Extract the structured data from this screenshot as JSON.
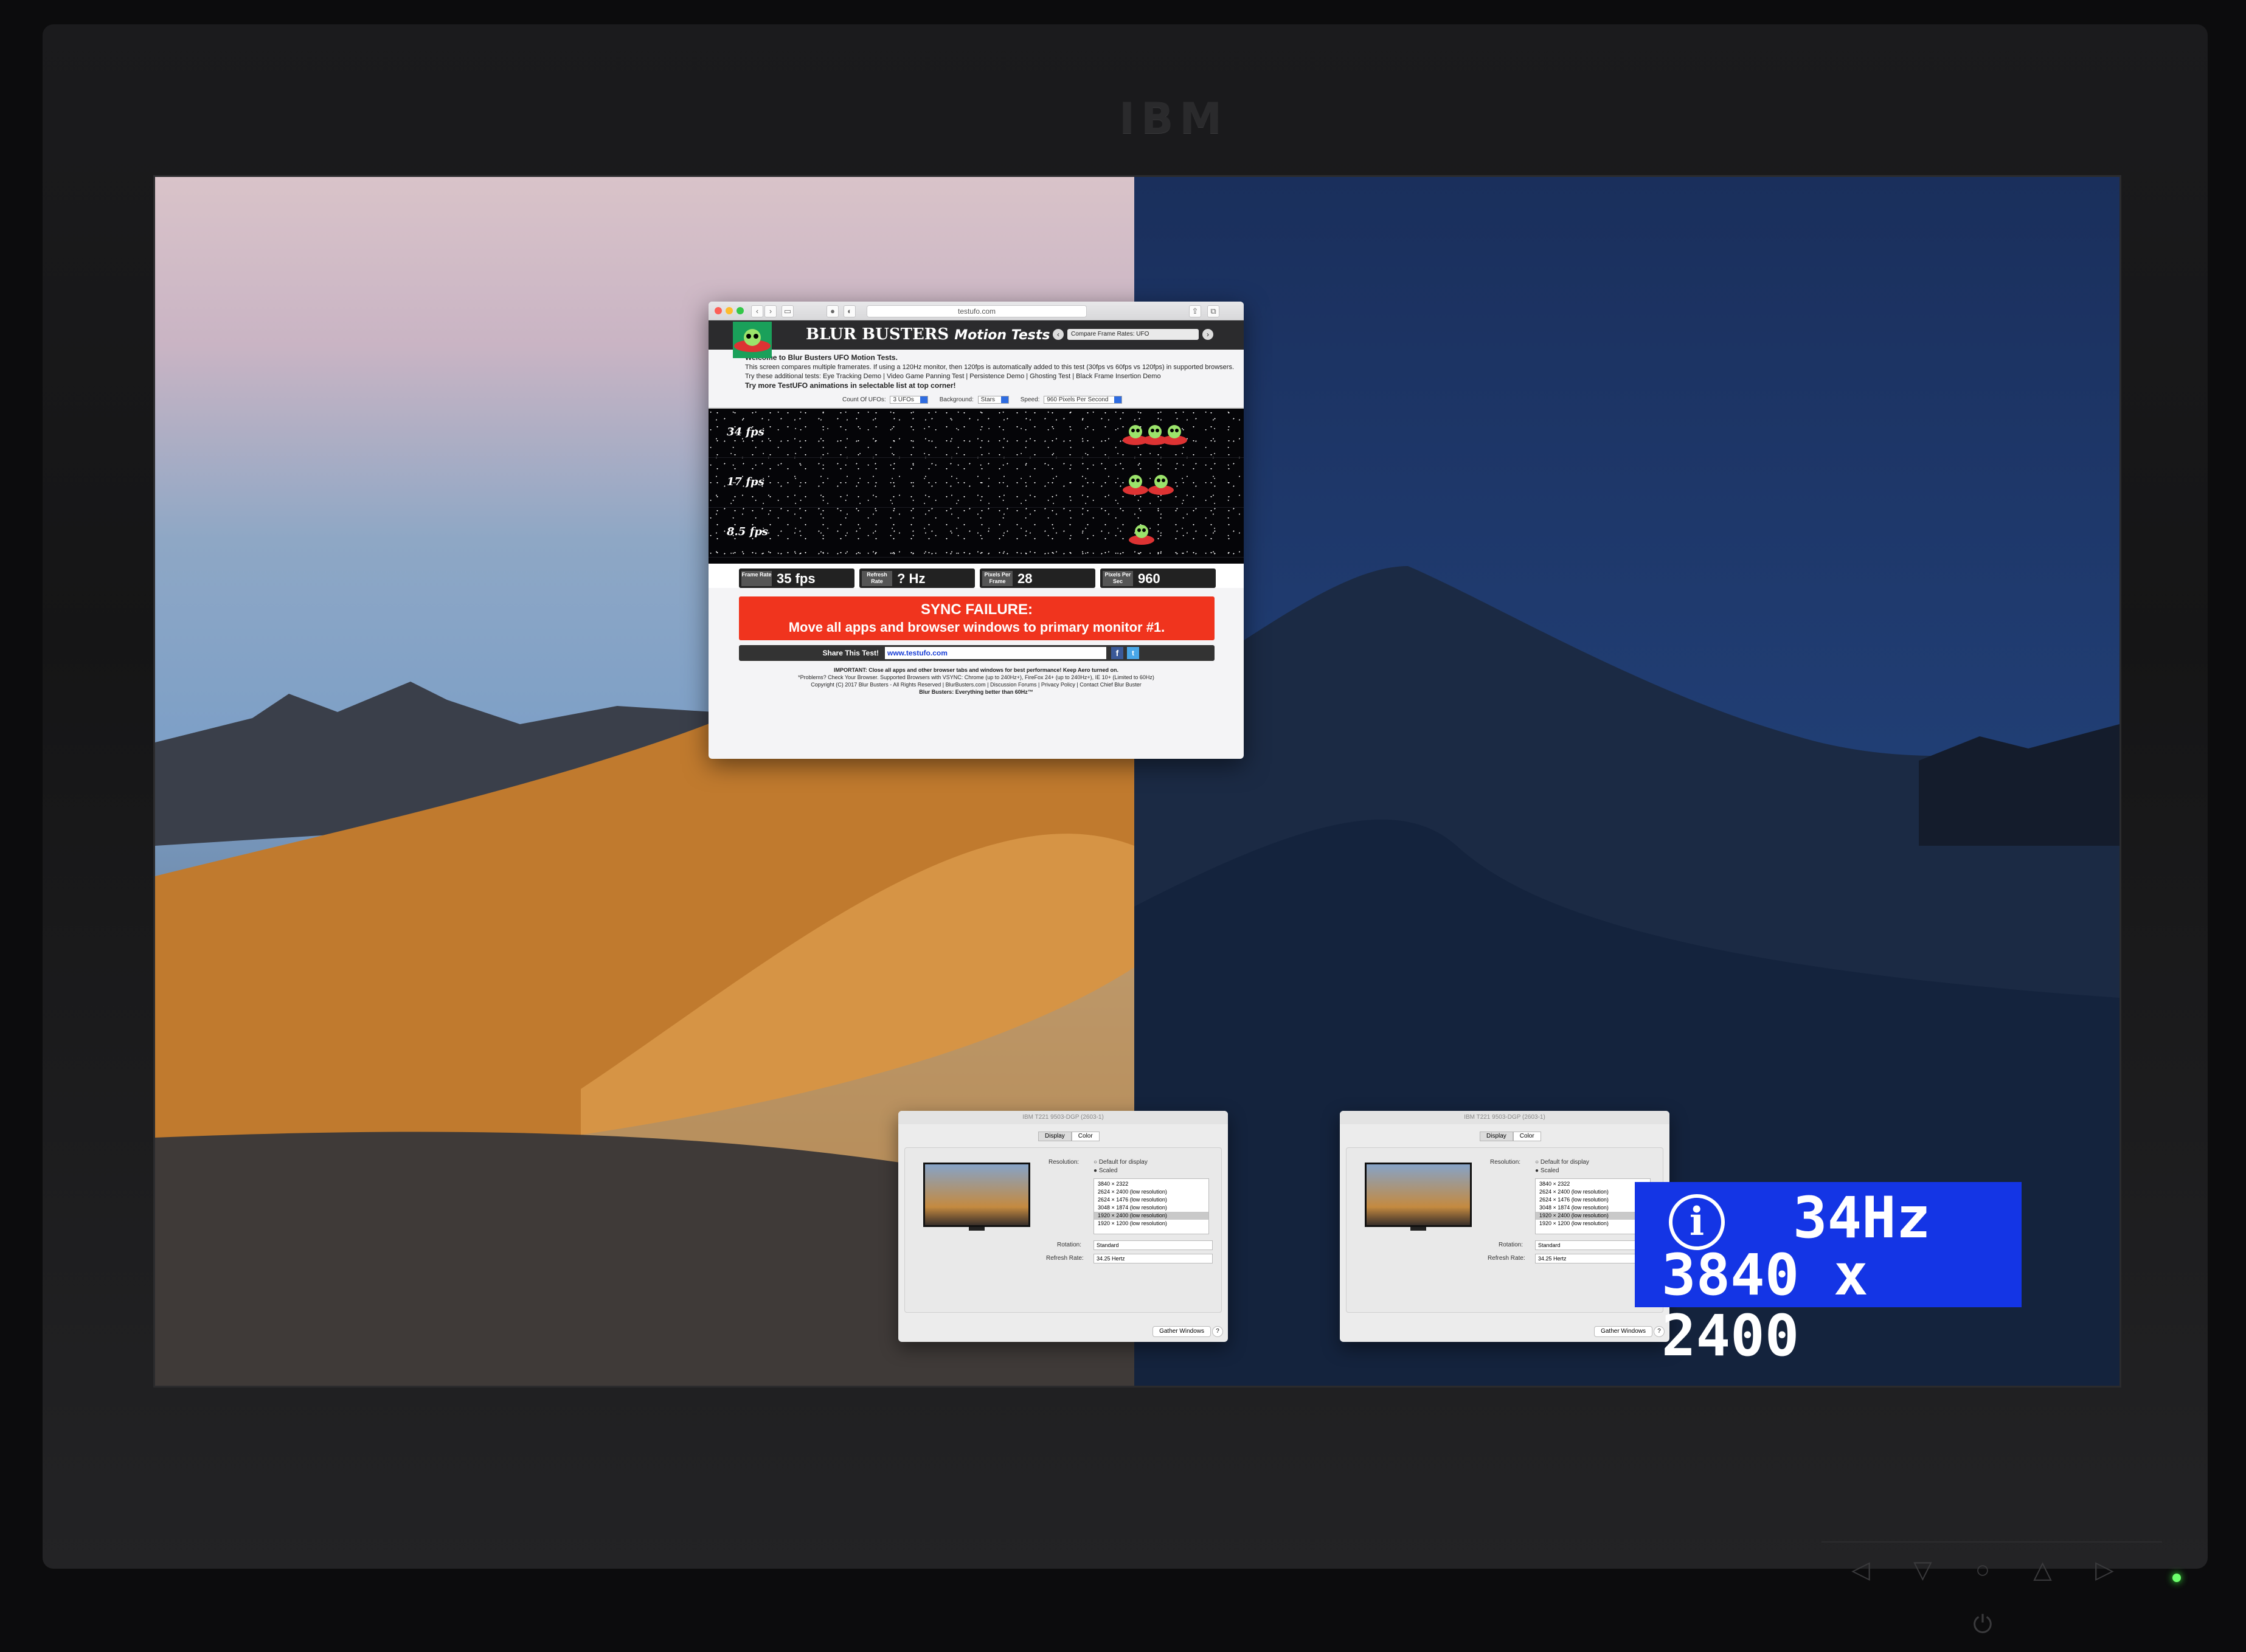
{
  "monitor": {
    "brand": "IBM",
    "osd": {
      "refresh": "34Hz",
      "resolution": "3840 x 2400",
      "icon": "info-icon"
    }
  },
  "browser": {
    "url": "testufo.com",
    "site_title": "BLUR BUSTERS",
    "site_subtitle": "Motion Tests",
    "compare_select": "Compare Frame Rates: UFO",
    "intro_title": "Welcome to Blur Busters UFO Motion Tests.",
    "intro_line1": "This screen compares multiple framerates. If using a 120Hz monitor, then 120fps is automatically added to this test (30fps vs 60fps vs 120fps) in supported browsers.",
    "intro_line2": "Try these additional tests: Eye Tracking Demo | Video Game Panning Test | Persistence Demo | Ghosting Test | Black Frame Insertion Demo",
    "intro_line3": "Try more TestUFO animations in selectable list at top corner!",
    "controls": {
      "count_label": "Count Of UFOs:",
      "count_value": "3 UFOs",
      "background_label": "Background:",
      "background_value": "Stars",
      "speed_label": "Speed:",
      "speed_value": "960 Pixels Per Second"
    },
    "lanes": [
      "34 fps",
      "17 fps",
      "8.5 fps"
    ],
    "stats": [
      {
        "label": "Frame Rate",
        "value": "35 fps"
      },
      {
        "label": "Refresh Rate",
        "value": "? Hz"
      },
      {
        "label": "Pixels Per Frame",
        "value": "28"
      },
      {
        "label": "Pixels Per Sec",
        "value": "960"
      }
    ],
    "sync_title": "SYNC FAILURE:",
    "sync_message": "Move all apps and browser windows to primary monitor #1.",
    "share_label": "Share This Test!",
    "share_url": "www.testufo.com",
    "footer": [
      "IMPORTANT: Close all apps and other browser tabs and windows for best performance! Keep Aero turned on.",
      "*Problems? Check Your Browser. Supported Browsers with VSYNC: Chrome (up to 240Hz+), FireFox 24+ (up to 240Hz+), IE 10+ (Limited to 60Hz)",
      "Copyright (C) 2017 Blur Busters - All Rights Reserved | BlurBusters.com | Discussion Forums | Privacy Policy | Contact Chief Blur Buster",
      "Blur Busters: Everything better than 60Hz™"
    ]
  },
  "display_prefs": [
    {
      "title": "IBM T221 9503-DGP (2603-1)",
      "tabs": [
        "Display",
        "Color"
      ],
      "resolution_label": "Resolution:",
      "opt_default": "Default for display",
      "opt_scaled": "Scaled",
      "resolutions": [
        "3840 × 2322",
        "2624 × 2400 (low resolution)",
        "2624 × 1476 (low resolution)",
        "3048 × 1874 (low resolution)",
        "1920 × 2400 (low resolution)",
        "1920 × 1200 (low resolution)"
      ],
      "rotation_label": "Rotation:",
      "rotation_value": "Standard",
      "refresh_label": "Refresh Rate:",
      "refresh_value": "34.25 Hertz",
      "gather_label": "Gather Windows"
    },
    {
      "title": "IBM T221 9503-DGP (2603-1)",
      "tabs": [
        "Display",
        "Color"
      ],
      "resolution_label": "Resolution:",
      "opt_default": "Default for display",
      "opt_scaled": "Scaled",
      "resolutions": [
        "3840 × 2322",
        "2624 × 2400 (low resolution)",
        "2624 × 1476 (low resolution)",
        "3048 × 1874 (low resolution)",
        "1920 × 2400 (low resolution)",
        "1920 × 1200 (low resolution)"
      ],
      "rotation_label": "Rotation:",
      "rotation_value": "Standard",
      "refresh_label": "Refresh Rate:",
      "refresh_value": "34.25 Hertz",
      "gather_label": "Gather Windows"
    }
  ],
  "colors": {
    "sync_red": "#f0341e",
    "osd_blue": "#1435e5",
    "link_blue": "#1a3fd6"
  }
}
